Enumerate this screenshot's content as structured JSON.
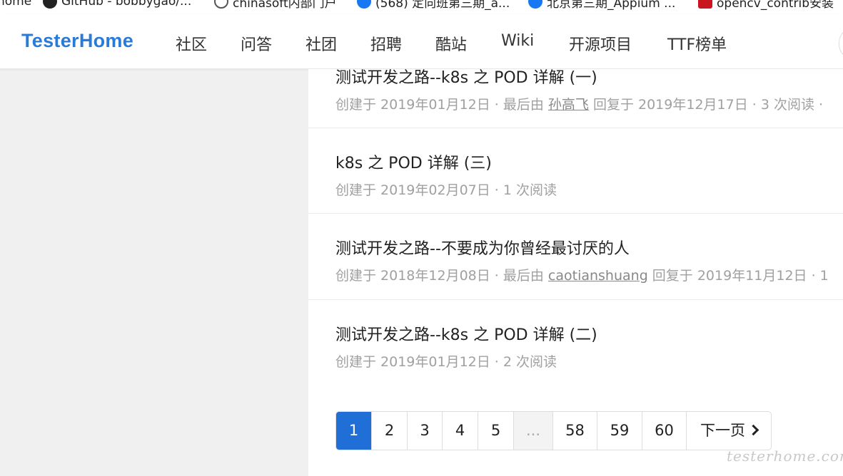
{
  "bookmarks": [
    {
      "label": "home",
      "icon": "bookmark-text"
    },
    {
      "label": "GitHub - bobbygao/...",
      "icon": "github-icon"
    },
    {
      "label": "chinasoft内部门户",
      "icon": "globe-icon"
    },
    {
      "label": "(568) 定向班第三期_a...",
      "icon": "facebook-icon"
    },
    {
      "label": "北京第三期_Appium ...",
      "icon": "facebook-icon"
    },
    {
      "label": "opencv_contrib安装",
      "icon": "csdn-icon"
    }
  ],
  "navbar": {
    "brand": "TesterHome",
    "items": [
      "社区",
      "问答",
      "社团",
      "招聘",
      "酷站",
      "Wiki",
      "开源项目",
      "TTF榜单"
    ]
  },
  "topics": [
    {
      "title": "测试开发之路--k8s 之 POD 详解 (一)",
      "meta_prefix": "创建于 2019年01月12日 · 最后由 ",
      "user": "孙高飞",
      "meta_suffix": " 回复于 2019年12月17日 · 3 次阅读 ·"
    },
    {
      "title": "k8s 之 POD 详解 (三)",
      "meta_prefix": "创建于 2019年02月07日 · 1 次阅读",
      "user": "",
      "meta_suffix": ""
    },
    {
      "title": "测试开发之路--不要成为你曾经最讨厌的人",
      "meta_prefix": "创建于 2018年12月08日 · 最后由 ",
      "user": "caotianshuang",
      "meta_suffix": " 回复于 2019年11月12日 · 1"
    },
    {
      "title": "测试开发之路--k8s 之 POD 详解 (二)",
      "meta_prefix": "创建于 2019年01月12日 · 2 次阅读",
      "user": "",
      "meta_suffix": ""
    }
  ],
  "pagination": {
    "pages": [
      "1",
      "2",
      "3",
      "4",
      "5",
      "...",
      "58",
      "59",
      "60"
    ],
    "current": "1",
    "next_label": "下一页"
  },
  "watermark": "testerhome.com",
  "colors": {
    "brand": "#2a7ad8",
    "active_page": "#1f6fd7"
  }
}
